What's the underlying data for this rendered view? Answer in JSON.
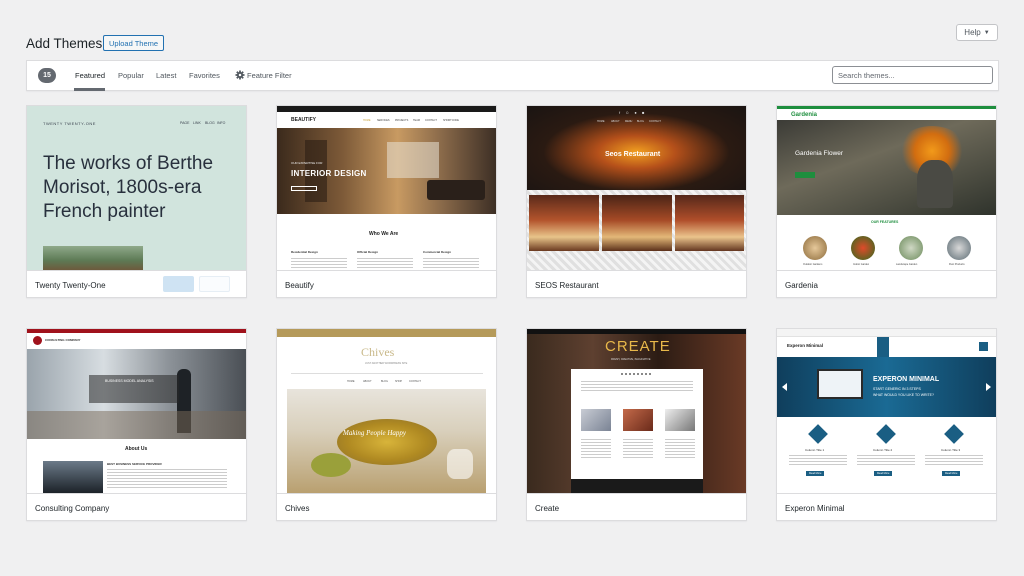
{
  "header": {
    "title": "Add Themes",
    "upload_label": "Upload Theme",
    "help_label": "Help"
  },
  "filter": {
    "count": "15",
    "tabs": [
      "Featured",
      "Popular",
      "Latest",
      "Favorites"
    ],
    "feature_filter_label": "Feature Filter",
    "search_placeholder": "Search themes..."
  },
  "themes": [
    {
      "name": "Twenty Twenty-One",
      "preview": {
        "site_title": "TWENTY TWENTY-ONE",
        "nav": [
          "PAGE",
          "LINK",
          "BLOG",
          "INFO"
        ],
        "headline": [
          "The works of Berthe",
          "Morisot, 1800s-era",
          "French painter"
        ]
      }
    },
    {
      "name": "Beautify",
      "preview": {
        "logo": "BEAUTIFY",
        "nav": [
          "HOME",
          "SERVICES",
          "PROJECTS",
          "TEAM",
          "CONTACT",
          "SHORTCODE"
        ],
        "hero_small": "OUR EXPERTISE FOR",
        "hero": "INTERIOR DESIGN",
        "section": "Who We Are",
        "columns": [
          "Residential Design",
          "Official Design",
          "Commercial Design"
        ]
      }
    },
    {
      "name": "SEOS Restaurant",
      "preview": {
        "hero": "Seos Restaurant",
        "nav": [
          "HOME",
          "ABOUT",
          "MENU",
          "BLOG",
          "CONTACT"
        ]
      }
    },
    {
      "name": "Gardenia",
      "preview": {
        "logo": "Gardenia",
        "hero": "Gardenia Flower",
        "section": "OUR FEATURES",
        "features": [
          "Outdoor Gardens",
          "Indoor Garden",
          "Landscape Garden",
          "Pest Products"
        ]
      }
    },
    {
      "name": "Consulting Company",
      "preview": {
        "logo_text": "CONSULTING COMPANY",
        "hero": "BUSINESS MODEL ANALYSIS",
        "section": "About Us",
        "sub": "BEST BUSINESS SERVICE PROVIDER"
      }
    },
    {
      "name": "Chives",
      "preview": {
        "logo": "Chives",
        "tagline": "JUST ANOTHER WORDPRESS SITE",
        "nav": [
          "HOME",
          "ABOUT",
          "BLOG",
          "SHOP",
          "CONTACT"
        ],
        "script": "Making People Happy"
      }
    },
    {
      "name": "Create",
      "preview": {
        "logo": "CREATE",
        "tagline": "FRESH, CREATIVE, IMAGINATIVE"
      }
    },
    {
      "name": "Experon Minimal",
      "preview": {
        "logo": "Experon Minimal",
        "hero": "EXPERON MINIMAL",
        "hero_sub1": "START GENERIC IN 3 STEPS",
        "hero_sub2": "WHAT WOULD YOU LIKE TO WRITE?",
        "features": [
          "Column Title 1",
          "Column Title 2",
          "Column Title 3"
        ],
        "button": "Read More"
      }
    }
  ],
  "colors": {
    "accent": "#2271b1",
    "background": "#f0f0f1",
    "gardenia_green": "#1e8e3e",
    "experon_blue": "#1a5e83",
    "consulting_red": "#a0121c"
  },
  "icons": {
    "gear": "gear-icon",
    "help_caret": "triangle-down"
  }
}
